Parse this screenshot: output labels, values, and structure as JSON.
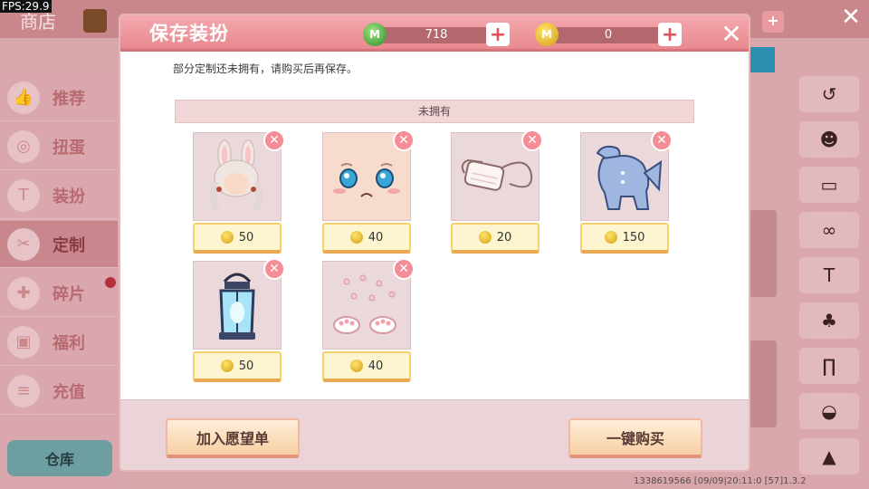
{
  "status": {
    "fps": "FPS:29.9"
  },
  "background": {
    "store_title": "商店",
    "sidebar": [
      {
        "label": "推荐",
        "icon": "thumbs-up-icon"
      },
      {
        "label": "扭蛋",
        "icon": "capsule-icon"
      },
      {
        "label": "装扮",
        "icon": "shirt-icon"
      },
      {
        "label": "定制",
        "icon": "scissors-icon"
      },
      {
        "label": "碎片",
        "icon": "puzzle-icon"
      },
      {
        "label": "福利",
        "icon": "gift-icon"
      },
      {
        "label": "充值",
        "icon": "coin-stack-icon"
      }
    ],
    "warehouse_label": "仓库",
    "footer_text": "1338619566 [09/09|20:11:0 [57]1.3.2"
  },
  "dialog": {
    "title": "保存装扮",
    "currency": {
      "gem_value": "718",
      "gem_glyph": "M",
      "coin_value": "0",
      "coin_glyph": "M"
    },
    "notice": "部分定制还未拥有，请购买后再保存。",
    "section_title": "未拥有",
    "items": [
      {
        "name": "bunny-ear-hair",
        "price": "50"
      },
      {
        "name": "crying-face",
        "price": "40"
      },
      {
        "name": "face-mask",
        "price": "20"
      },
      {
        "name": "fish-costume",
        "price": "150"
      },
      {
        "name": "blue-lantern",
        "price": "50"
      },
      {
        "name": "paw-prints",
        "price": "40"
      }
    ],
    "wishlist_label": "加入愿望单",
    "buy_all_label": "一键购买"
  },
  "colors": {
    "accent": "#e8898f",
    "price_border": "#f4d16c",
    "button": "#f7cfa3"
  }
}
